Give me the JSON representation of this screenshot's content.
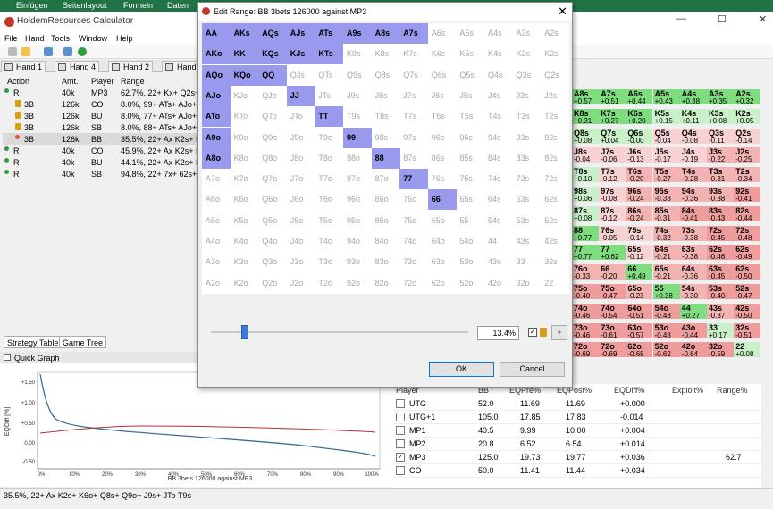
{
  "ribbon": [
    "Einfügen",
    "Seitenlayout",
    "Formeln",
    "Daten"
  ],
  "app_title": "HoldemResources Calculator",
  "menu": [
    "File",
    "Hand",
    "Tools",
    "Window",
    "Help"
  ],
  "hand_tabs": [
    "Hand 1",
    "Hand 4",
    "Hand 2",
    "Hand"
  ],
  "action_headers": [
    "Action",
    "Amt.",
    "Player",
    "Range"
  ],
  "actions": [
    {
      "action": "R",
      "amt": "40k",
      "player": "MP3",
      "range": "62.7%, 22+ Kx+ Q2s+",
      "icon": "green-dot"
    },
    {
      "action": "3B",
      "amt": "126k",
      "player": "CO",
      "range": "8.0%, 99+ ATs+ AJo+",
      "icon": "lock"
    },
    {
      "action": "3B",
      "amt": "126k",
      "player": "BU",
      "range": "8.0%, 77+ ATs+ AJo+",
      "icon": "lock"
    },
    {
      "action": "3B",
      "amt": "126k",
      "player": "SB",
      "range": "8.0%, 88+ ATs+ AJo+",
      "icon": "lock"
    },
    {
      "action": "3B",
      "amt": "126k",
      "player": "BB",
      "range": "35.5%, 22+ Ax K2s+ K",
      "icon": "red-dot"
    },
    {
      "action": "R",
      "amt": "40k",
      "player": "CO",
      "range": "45.9%, 22+ Ax K2s+ K",
      "icon": "green-dot"
    },
    {
      "action": "R",
      "amt": "40k",
      "player": "BU",
      "range": "44.1%, 22+ Ax K2s+ K",
      "icon": "green-dot"
    },
    {
      "action": "R",
      "amt": "40k",
      "player": "SB",
      "range": "94.8%, 22+ 7x+ 62s+",
      "icon": "green-dot"
    }
  ],
  "strategy_tabs": [
    "Strategy Table",
    "Game Tree"
  ],
  "quick_graph": {
    "title": "Quick Graph",
    "ylabel": "EQDiff [%]",
    "xlabel": "BB 3bets 126000 against MP3",
    "yticks": [
      "+1.50",
      "+1.00",
      "+0.50",
      "0.00",
      "-0.50"
    ],
    "xticks": [
      "0%",
      "10%",
      "20%",
      "30%",
      "40%",
      "50%",
      "60%",
      "70%",
      "80%",
      "90%",
      "100%"
    ]
  },
  "dialog": {
    "title": "Edit Range: BB 3bets 126000 against MP3",
    "percent": "13.4%",
    "ok": "OK",
    "cancel": "Cancel",
    "hands": [
      [
        "AA",
        "AKs",
        "AQs",
        "AJs",
        "ATs",
        "A9s",
        "A8s",
        "A7s",
        "A6s",
        "A5s",
        "A4s",
        "A3s",
        "A2s"
      ],
      [
        "AKo",
        "KK",
        "KQs",
        "KJs",
        "KTs",
        "K9s",
        "K8s",
        "K7s",
        "K6s",
        "K5s",
        "K4s",
        "K3s",
        "K2s"
      ],
      [
        "AQo",
        "KQo",
        "QQ",
        "QJs",
        "QTs",
        "Q9s",
        "Q8s",
        "Q7s",
        "Q6s",
        "Q5s",
        "Q4s",
        "Q3s",
        "Q2s"
      ],
      [
        "AJo",
        "KJo",
        "QJo",
        "JJ",
        "JTs",
        "J9s",
        "J8s",
        "J7s",
        "J6s",
        "J5s",
        "J4s",
        "J3s",
        "J2s"
      ],
      [
        "ATo",
        "KTo",
        "QTo",
        "JTo",
        "TT",
        "T9s",
        "T8s",
        "T7s",
        "T6s",
        "T5s",
        "T4s",
        "T3s",
        "T2s"
      ],
      [
        "A9o",
        "K9o",
        "Q9o",
        "J9o",
        "T9o",
        "99",
        "98s",
        "97s",
        "96s",
        "95s",
        "94s",
        "93s",
        "92s"
      ],
      [
        "A8o",
        "K8o",
        "Q8o",
        "J8o",
        "T8o",
        "98o",
        "88",
        "87s",
        "86s",
        "85s",
        "84s",
        "83s",
        "82s"
      ],
      [
        "A7o",
        "K7o",
        "Q7o",
        "J7o",
        "T7o",
        "97o",
        "87o",
        "77",
        "76s",
        "75s",
        "74s",
        "73s",
        "72s"
      ],
      [
        "A6o",
        "K6o",
        "Q6o",
        "J6o",
        "T6o",
        "96o",
        "86o",
        "76o",
        "66",
        "65s",
        "64s",
        "63s",
        "62s"
      ],
      [
        "A5o",
        "K5o",
        "Q5o",
        "J5o",
        "T5o",
        "95o",
        "85o",
        "75o",
        "65o",
        "55",
        "54s",
        "53s",
        "52s"
      ],
      [
        "A4o",
        "K4o",
        "Q4o",
        "J4o",
        "T4o",
        "94o",
        "84o",
        "74o",
        "64o",
        "54o",
        "44",
        "43s",
        "42s"
      ],
      [
        "A3o",
        "K3o",
        "Q3o",
        "J3o",
        "T3o",
        "93o",
        "83o",
        "73o",
        "63o",
        "53o",
        "43o",
        "33",
        "32s"
      ],
      [
        "A2o",
        "K2o",
        "Q2o",
        "J2o",
        "T2o",
        "92o",
        "82o",
        "72o",
        "62o",
        "52o",
        "42o",
        "32o",
        "22"
      ]
    ],
    "selected": [
      [
        1,
        1,
        1,
        1,
        1,
        1,
        1,
        1,
        0,
        0,
        0,
        0,
        0
      ],
      [
        1,
        1,
        1,
        1,
        1,
        0,
        0,
        0,
        0,
        0,
        0,
        0,
        0
      ],
      [
        1,
        1,
        1,
        0,
        0,
        0,
        0,
        0,
        0,
        0,
        0,
        0,
        0
      ],
      [
        1,
        0,
        0,
        1,
        0,
        0,
        0,
        0,
        0,
        0,
        0,
        0,
        0
      ],
      [
        1,
        0,
        0,
        0,
        1,
        0,
        0,
        0,
        0,
        0,
        0,
        0,
        0
      ],
      [
        1,
        0,
        0,
        0,
        0,
        1,
        0,
        0,
        0,
        0,
        0,
        0,
        0
      ],
      [
        1,
        0,
        0,
        0,
        0,
        0,
        1,
        0,
        0,
        0,
        0,
        0,
        0
      ],
      [
        0,
        0,
        0,
        0,
        0,
        0,
        0,
        1,
        0,
        0,
        0,
        0,
        0
      ],
      [
        0,
        0,
        0,
        0,
        0,
        0,
        0,
        0,
        1,
        0,
        0,
        0,
        0
      ],
      [
        0,
        0,
        0,
        0,
        0,
        0,
        0,
        0,
        0,
        0,
        0,
        0,
        0
      ],
      [
        0,
        0,
        0,
        0,
        0,
        0,
        0,
        0,
        0,
        0,
        0,
        0,
        0
      ],
      [
        0,
        0,
        0,
        0,
        0,
        0,
        0,
        0,
        0,
        0,
        0,
        0,
        0
      ],
      [
        0,
        0,
        0,
        0,
        0,
        0,
        0,
        0,
        0,
        0,
        0,
        0,
        0
      ]
    ]
  },
  "right_matrix": [
    [
      [
        "A8s",
        "+0.57"
      ],
      [
        "A7s",
        "+0.51"
      ],
      [
        "A6s",
        "+0.44"
      ],
      [
        "A5s",
        "+0.43"
      ],
      [
        "A4s",
        "+0.38"
      ],
      [
        "A3s",
        "+0.35"
      ],
      [
        "A2s",
        "+0.32"
      ]
    ],
    [
      [
        "K8s",
        "+0.31"
      ],
      [
        "K7s",
        "+0.27"
      ],
      [
        "K6s",
        "+0.20"
      ],
      [
        "K5s",
        "+0.15"
      ],
      [
        "K4s",
        "+0.11"
      ],
      [
        "K3s",
        "+0.08"
      ],
      [
        "K2s",
        "+0.05"
      ]
    ],
    [
      [
        "Q8s",
        "+0.08"
      ],
      [
        "Q7s",
        "+0.04"
      ],
      [
        "Q6s",
        "-0.00"
      ],
      [
        "Q5s",
        "-0.04"
      ],
      [
        "Q4s",
        "-0.08"
      ],
      [
        "Q3s",
        "-0.11"
      ],
      [
        "Q2s",
        "-0.14"
      ]
    ],
    [
      [
        "J8s",
        "-0.04"
      ],
      [
        "J7s",
        "-0.06"
      ],
      [
        "J6s",
        "-0.13"
      ],
      [
        "J5s",
        "-0.17"
      ],
      [
        "J4s",
        "-0.19"
      ],
      [
        "J3s",
        "-0.22"
      ],
      [
        "J2s",
        "-0.25"
      ]
    ],
    [
      [
        "T8s",
        "+0.10"
      ],
      [
        "T7s",
        "-0.12"
      ],
      [
        "T6s",
        "-0.20"
      ],
      [
        "T5s",
        "-0.27"
      ],
      [
        "T4s",
        "-0.28"
      ],
      [
        "T3s",
        "-0.31"
      ],
      [
        "T2s",
        "-0.34"
      ]
    ],
    [
      [
        "98s",
        "+0.06"
      ],
      [
        "97s",
        "-0.08"
      ],
      [
        "96s",
        "-0.24"
      ],
      [
        "95s",
        "-0.33"
      ],
      [
        "94s",
        "-0.36"
      ],
      [
        "93s",
        "-0.38"
      ],
      [
        "92s",
        "-0.41"
      ]
    ],
    [
      [
        "87s",
        "+0.08"
      ],
      [
        "87s",
        "-0.12"
      ],
      [
        "86s",
        "-0.24"
      ],
      [
        "85s",
        "-0.31"
      ],
      [
        "84s",
        "-0.41"
      ],
      [
        "83s",
        "-0.43"
      ],
      [
        "82s",
        "-0.44"
      ]
    ],
    [
      [
        "88",
        "+0.77"
      ],
      [
        "76s",
        "-0.05"
      ],
      [
        "75s",
        "-0.14"
      ],
      [
        "74s",
        "-0.32"
      ],
      [
        "73s",
        "-0.38"
      ],
      [
        "72s",
        "-0.45"
      ],
      [
        "72s",
        "-0.48"
      ]
    ],
    [
      [
        "77",
        "+0.77"
      ],
      [
        "77",
        "+0.62"
      ],
      [
        "65s",
        "-0.12"
      ],
      [
        "64s",
        "-0.21"
      ],
      [
        "63s",
        "-0.38"
      ],
      [
        "62s",
        "-0.46"
      ],
      [
        "62s",
        "-0.49"
      ]
    ],
    [
      [
        "76o",
        "-0.33"
      ],
      [
        "66",
        "-0.20"
      ],
      [
        "66",
        "+0.49"
      ],
      [
        "65s",
        "-0.21"
      ],
      [
        "64s",
        "-0.36"
      ],
      [
        "63s",
        "-0.45"
      ],
      [
        "62s",
        "-0.50"
      ]
    ],
    [
      [
        "75o",
        "-0.40"
      ],
      [
        "75o",
        "-0.47"
      ],
      [
        "65o",
        "-0.23"
      ],
      [
        "55",
        "+0.38"
      ],
      [
        "54s",
        "-0.30"
      ],
      [
        "53s",
        "-0.40"
      ],
      [
        "52s",
        "-0.47"
      ]
    ],
    [
      [
        "74o",
        "-0.46"
      ],
      [
        "74o",
        "-0.54"
      ],
      [
        "64o",
        "-0.51"
      ],
      [
        "54o",
        "-0.48"
      ],
      [
        "44",
        "+0.27"
      ],
      [
        "43s",
        "-0.37"
      ],
      [
        "42s",
        "-0.50"
      ]
    ],
    [
      [
        "73o",
        "-0.46"
      ],
      [
        "73o",
        "-0.61"
      ],
      [
        "63o",
        "-0.57"
      ],
      [
        "53o",
        "-0.48"
      ],
      [
        "43o",
        "-0.44"
      ],
      [
        "33",
        "+0.17"
      ],
      [
        "32s",
        "-0.51"
      ]
    ],
    [
      [
        "72o",
        "-0.69"
      ],
      [
        "72o",
        "-0.69"
      ],
      [
        "62o",
        "-0.68"
      ],
      [
        "52o",
        "-0.62"
      ],
      [
        "42o",
        "-0.64"
      ],
      [
        "32o",
        "-0.59"
      ],
      [
        "22",
        "+0.08"
      ]
    ]
  ],
  "player_table": {
    "headers": [
      "Player",
      "BB",
      "EQPre%",
      "EQPost%",
      "EQDiff%",
      "Exploit%",
      "Range%"
    ],
    "rows": [
      {
        "checked": false,
        "player": "UTG",
        "bb": "52.0",
        "eqpre": "11.69",
        "eqpost": "11.69",
        "eqdiff": "+0.000",
        "exploit": "",
        "range": ""
      },
      {
        "checked": false,
        "player": "UTG+1",
        "bb": "105.0",
        "eqpre": "17.85",
        "eqpost": "17.83",
        "eqdiff": "-0.014",
        "exploit": "",
        "range": ""
      },
      {
        "checked": false,
        "player": "MP1",
        "bb": "40.5",
        "eqpre": "9.99",
        "eqpost": "10.00",
        "eqdiff": "+0.004",
        "exploit": "",
        "range": ""
      },
      {
        "checked": false,
        "player": "MP2",
        "bb": "20.8",
        "eqpre": "6.52",
        "eqpost": "6.54",
        "eqdiff": "+0.014",
        "exploit": "",
        "range": ""
      },
      {
        "checked": true,
        "player": "MP3",
        "bb": "125.0",
        "eqpre": "19.73",
        "eqpost": "19.77",
        "eqdiff": "+0.036",
        "exploit": "",
        "range": "62.7"
      },
      {
        "checked": false,
        "player": "CO",
        "bb": "50.0",
        "eqpre": "11.41",
        "eqpost": "11.44",
        "eqdiff": "+0.034",
        "exploit": "",
        "range": ""
      }
    ]
  },
  "status": "35.5%, 22+ Ax K2s+ K6o+ Q8s+ Q9o+ J9s+ JTo T9s",
  "colors": {
    "selected_cell": "#9999ee",
    "excel_green": "#217346",
    "positive": "#9be59b",
    "negative": "#f2a6a6"
  }
}
